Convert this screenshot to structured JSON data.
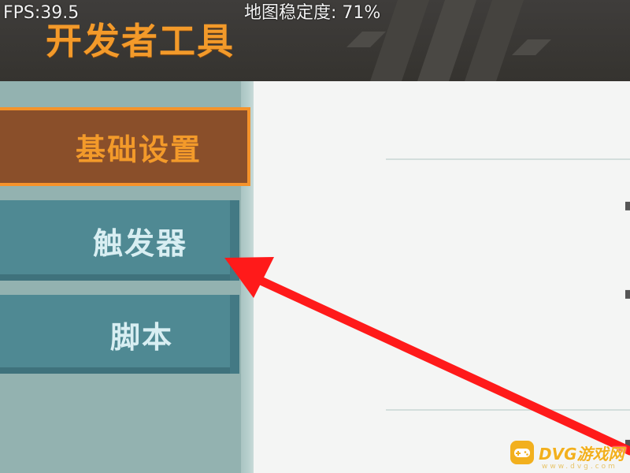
{
  "header": {
    "fps_text": "FPS:39.5",
    "stability_text": "地图稳定度: 71%",
    "title": "开发者工具"
  },
  "sidebar": {
    "items": [
      {
        "label": "基础设置",
        "selected": true
      },
      {
        "label": "触发器",
        "selected": false
      },
      {
        "label": "脚本",
        "selected": false
      }
    ]
  },
  "watermark": {
    "text": "DVG游戏网",
    "sub_text": "www.dvg.com"
  },
  "colors": {
    "header_bg": "#3f3d3b",
    "title_orange": "#f39a2a",
    "selected_item_bg": "#8a4f2a",
    "selected_item_border": "#f5932b",
    "item_bg": "#4f8993",
    "sidebar_bg": "#93b2b0",
    "content_bg": "#f4f5f4",
    "arrow_red": "#ff1a1a",
    "watermark_yellow": "#f2b01e"
  },
  "icons": {
    "annotation": "red-arrow-icon",
    "watermark_logo": "gamepad-icon"
  }
}
